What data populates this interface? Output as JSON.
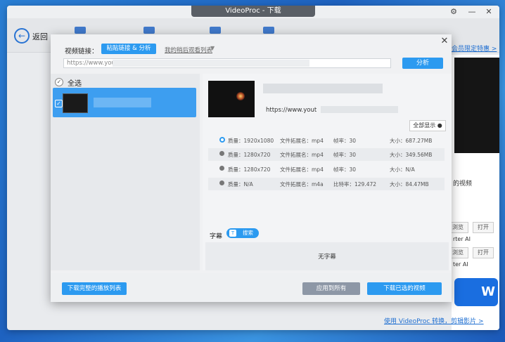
{
  "window": {
    "title": "VideoProc - 下载"
  },
  "toolbar": {
    "back_label": "返回"
  },
  "right_panel": {
    "top_link": "会员限定特惠 >",
    "text1": "的视频",
    "btn_a": "浏览",
    "btn_b": "打开",
    "text2": "rter AI",
    "text3": "ter AI",
    "big_label": "W",
    "bottom_link": "使用 VideoProc 转换，剪辑影片 >"
  },
  "dialog": {
    "url_label": "视频链接：",
    "paste_button": "粘贴链接 & 分析",
    "recent_link": "我的稍后观看列表",
    "url_value": "https://www.yout",
    "analyze_button": "分析",
    "select_all": "全选",
    "detail_url": "https://www.yout",
    "show_all_button": "全部显示",
    "formats": [
      {
        "quality": "质量：1920x1080",
        "ext": "文件拓展名：mp4",
        "rate": "帧率：30",
        "size": "大小：687.27MB",
        "selected": true
      },
      {
        "quality": "质量：1280x720",
        "ext": "文件拓展名：mp4",
        "rate": "帧率：30",
        "size": "大小：349.56MB",
        "selected": false
      },
      {
        "quality": "质量：1280x720",
        "ext": "文件拓展名：mp4",
        "rate": "帧率：30",
        "size": "大小：N/A",
        "selected": false
      },
      {
        "quality": "质量：N/A",
        "ext": "文件拓展名：m4a",
        "rate": "比特率：129.472",
        "size": "大小：84.47MB",
        "selected": false
      }
    ],
    "subtitle_label": "字幕",
    "subtitle_search": "搜索",
    "no_subtitle": "无字幕",
    "download_playlist_button": "下载完整的播放列表",
    "apply_all_button": "应用到所有",
    "download_selected_button": "下载已选的视频"
  },
  "colors": {
    "accent": "#2c9af0",
    "selected_row": "#3d9ef0",
    "disabled": "#8d97a6"
  }
}
